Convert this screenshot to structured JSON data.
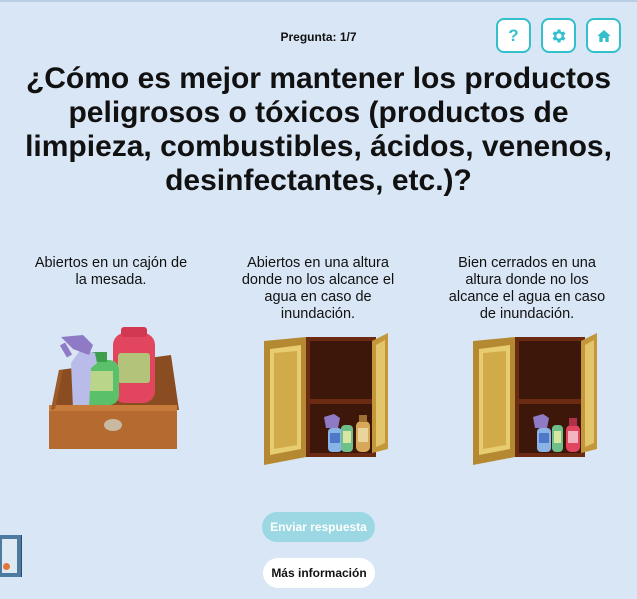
{
  "header": {
    "counter": "Pregunta: 1/7"
  },
  "toolbar": {
    "help_icon": "question-mark",
    "settings_icon": "gear",
    "home_icon": "house",
    "accent": "#33bfcb"
  },
  "question": {
    "text": "¿Cómo es mejor mantener los productos peligrosos o tóxicos (productos de limpieza, combustibles, ácidos, venenos, desinfectantes, etc.)?"
  },
  "options": [
    {
      "label": "Abiertos en un cajón de la mesada.",
      "image": "open-drawer-with-bottles"
    },
    {
      "label": "Abiertos en una altura donde no los alcance el agua en caso de inundación.",
      "image": "open-cabinet-with-bottles"
    },
    {
      "label": "Bien cerrados en una altura donde no los alcance el agua en caso de inundación.",
      "image": "open-cabinet-with-closed-bottles"
    }
  ],
  "actions": {
    "submit_label": "Enviar respuesta",
    "more_info_label": "Más información"
  }
}
